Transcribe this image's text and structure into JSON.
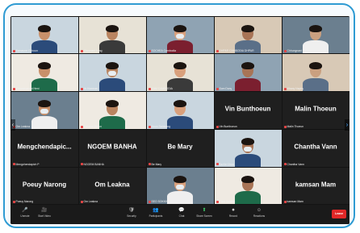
{
  "tiles": [
    {
      "label": "Samaune Chhoun",
      "name_only": false,
      "active": true
    },
    {
      "label": "Chounani Lung",
      "name_only": false
    },
    {
      "label": "SOCHEA Cambodia",
      "name_only": false
    },
    {
      "label": "DHPAR CAMBODIA DHPAR",
      "name_only": false
    },
    {
      "label": "Chhungnani Chhun",
      "name_only": false
    },
    {
      "label": "Chhunmanani Heni",
      "name_only": false
    },
    {
      "label": "Hr Homeasi",
      "name_only": false
    },
    {
      "label": "EAM CAMBODIA",
      "name_only": false
    },
    {
      "label": "Som Dany",
      "name_only": false
    },
    {
      "label": "Nhany Naphy",
      "name_only": false
    },
    {
      "label": "Om Leakna",
      "name_only": false
    },
    {
      "label": "Kakana Chhun",
      "name_only": false
    },
    {
      "label": "Noun Samnang",
      "name_only": false
    },
    {
      "big": "Vin Bunthoeun",
      "label": "Vin Bunthoeun",
      "name_only": true
    },
    {
      "big": "Malin Thoeun",
      "label": "Malin Thoeun",
      "name_only": true
    },
    {
      "big": "Mengchendapic...",
      "label": "Mengchendapich P",
      "name_only": true
    },
    {
      "big": "NGOEM BANHA",
      "label": "NGOEM BANHA",
      "name_only": true
    },
    {
      "big": "Be Mary",
      "label": "Be Mary",
      "name_only": true
    },
    {
      "label": "Sa Ke Chon",
      "name_only": false
    },
    {
      "big": "Chantha Vann",
      "label": "Chantha Vann",
      "name_only": true
    },
    {
      "big": "Poeuy Narong",
      "label": "Poeuy Narong",
      "name_only": true
    },
    {
      "big": "Om Leakna",
      "label": "Om Leakna",
      "name_only": true
    },
    {
      "label": "SEO SOKKHA",
      "name_only": false
    },
    {
      "label": "Thoit Sokmoi",
      "name_only": false
    },
    {
      "big": "kamsan Mam",
      "label": "kamsan Mam",
      "name_only": true
    }
  ],
  "toolbar": {
    "items": [
      {
        "icon": "microphone-icon",
        "glyph": "🎤",
        "label": "Unmute"
      },
      {
        "icon": "video-icon",
        "glyph": "🎥",
        "label": "Start Video"
      },
      {
        "icon": "security-icon",
        "glyph": "🛡",
        "label": "Security"
      },
      {
        "icon": "participants-icon",
        "glyph": "👥",
        "label": "Participants"
      },
      {
        "icon": "chat-icon",
        "glyph": "💬",
        "label": "Chat"
      },
      {
        "icon": "share-screen-icon",
        "glyph": "⬆",
        "label": "Share Screen"
      },
      {
        "icon": "record-icon",
        "glyph": "⏺",
        "label": "Record"
      },
      {
        "icon": "reactions-icon",
        "glyph": "☺",
        "label": "Reactions"
      }
    ],
    "leave_label": "Leave"
  },
  "colors": {
    "frame": "#2f9bd3",
    "active_speaker": "#9ee06a",
    "leave": "#e02828",
    "muted_mic": "#e64545"
  }
}
